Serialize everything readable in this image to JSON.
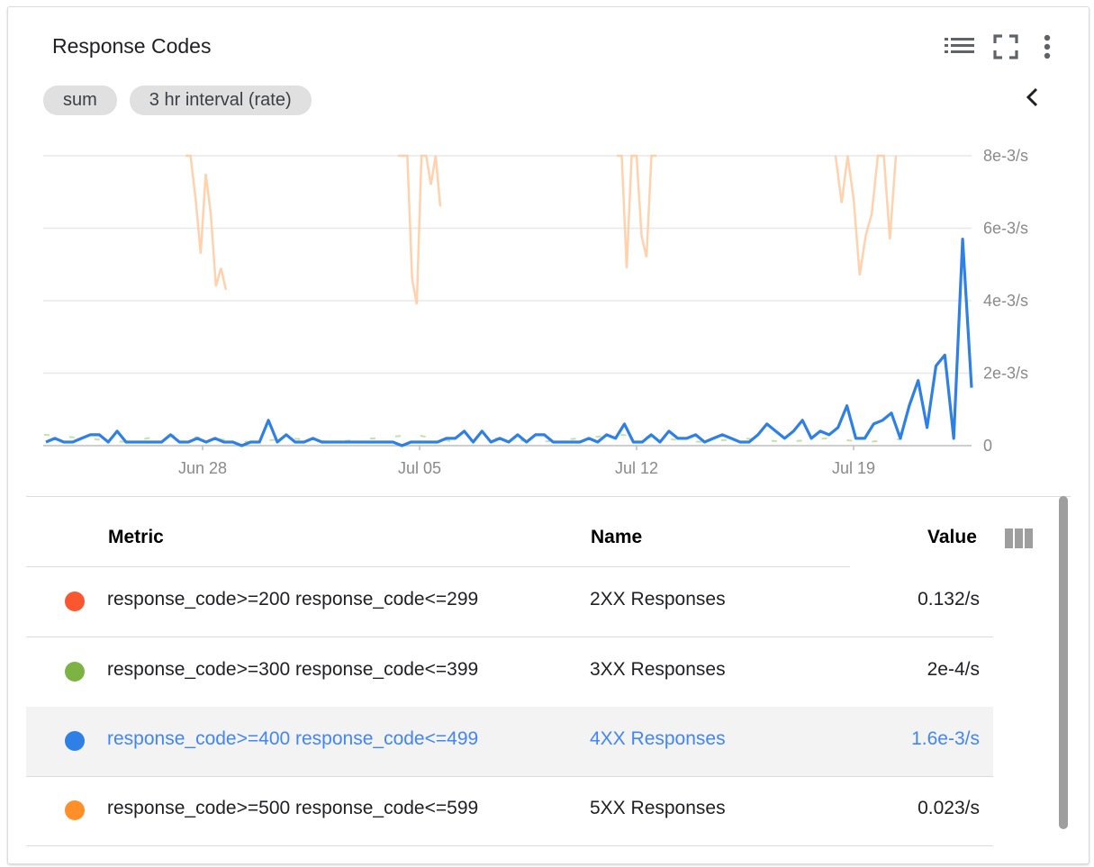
{
  "card": {
    "title": "Response Codes",
    "icons": [
      "legend-list-icon",
      "fullscreen-icon",
      "more-vert-icon",
      "chevron-left-icon",
      "columns-icon"
    ]
  },
  "chips": [
    {
      "label": "sum"
    },
    {
      "label": "3 hr interval (rate)"
    }
  ],
  "chart_data": {
    "type": "line",
    "y_ticks": [
      "8e-3/s",
      "6e-3/s",
      "4e-3/s",
      "2e-3/s",
      "0"
    ],
    "x_ticks": [
      "Jun 28",
      "Jul 05",
      "Jul 12",
      "Jul 19"
    ],
    "ylim": [
      0,
      0.008
    ],
    "grid": true,
    "series": [
      {
        "name": "5XX Responses",
        "color": "#ffcca3",
        "values": [
          0.008,
          0.008,
          0.0068,
          0.0053,
          0.0075,
          0.0064,
          0.0044,
          0.0049,
          0.0043,
          0.008,
          0.008,
          0.008,
          0.0046,
          0.0039,
          0.008,
          0.008,
          0.0072,
          0.008,
          0.0066,
          0.008,
          0.008,
          0.0049,
          0.008,
          0.008,
          0.0058,
          0.0052,
          0.008,
          0.008,
          0.008,
          0.0067,
          0.008,
          0.0068,
          0.0047,
          0.0058,
          0.0064,
          0.008,
          0.008,
          0.0057,
          0.008
        ]
      },
      {
        "name": "3XX Responses",
        "color": "#c5e1a5",
        "values": [
          0.0003,
          0.0002,
          0.0001,
          0.0003,
          0.0002,
          0.0001,
          0.0002,
          0.0001,
          0.0002,
          0.0003,
          0.0001,
          0.0002,
          0.0001,
          0.0002,
          0.0003,
          0.0002,
          0.0001,
          0.0002,
          0.0001,
          0.0002,
          0.0001,
          0.0002
        ]
      },
      {
        "name": "4XX Responses",
        "color": "#2f80e6",
        "values": [
          0.0001,
          0.0002,
          0.0001,
          0.0001,
          0.0002,
          0.0003,
          0.0003,
          0.0001,
          0.0004,
          0.0001,
          0.0001,
          0.0001,
          0.0001,
          0.0001,
          0.0003,
          0.0001,
          0.0001,
          0.0002,
          0.0001,
          0.0002,
          0.0001,
          0.0001,
          0.0,
          0.0001,
          0.0001,
          0.0007,
          0.0001,
          0.0003,
          0.0001,
          0.0001,
          0.0002,
          0.0001,
          0.0001,
          0.0001,
          0.0001,
          0.0001,
          0.0001,
          0.0001,
          0.0001,
          0.0001,
          0.0,
          0.0001,
          0.0001,
          0.0001,
          0.0001,
          0.0002,
          0.0002,
          0.0004,
          0.0001,
          0.0004,
          0.0001,
          0.0002,
          0.0001,
          0.0003,
          0.0001,
          0.0003,
          0.0003,
          0.0001,
          0.0001,
          0.0001,
          0.0001,
          0.0002,
          0.0001,
          0.0003,
          0.0002,
          0.0006,
          0.0001,
          0.0001,
          0.0003,
          0.0001,
          0.0004,
          0.0002,
          0.0002,
          0.0003,
          0.0001,
          0.0002,
          0.0003,
          0.0002,
          0.0001,
          0.0001,
          0.0003,
          0.0006,
          0.0004,
          0.0002,
          0.0004,
          0.0007,
          0.0002,
          0.0004,
          0.0003,
          0.0005,
          0.0011,
          0.0002,
          0.0002,
          0.0006,
          0.0007,
          0.0009,
          0.0002,
          0.0011,
          0.0018,
          0.0005,
          0.0022,
          0.0025,
          0.0002,
          0.0057,
          0.0016
        ]
      }
    ]
  },
  "legend": {
    "headers": {
      "metric": "Metric",
      "name": "Name",
      "value": "Value"
    },
    "rows": [
      {
        "color": "#fa5630",
        "metric": "response_code>=200 response_code<=299",
        "name": "2XX Responses",
        "value": "0.132/s"
      },
      {
        "color": "#7cb342",
        "metric": "response_code>=300 response_code<=399",
        "name": "3XX Responses",
        "value": "2e-4/s"
      },
      {
        "color": "#2f80e6",
        "metric": "response_code>=400 response_code<=499",
        "name": "4XX Responses",
        "value": "1.6e-3/s",
        "highlight": true
      },
      {
        "color": "#ff8f26",
        "metric": "response_code>=500 response_code<=599",
        "name": "5XX Responses",
        "value": "0.023/s"
      }
    ]
  }
}
